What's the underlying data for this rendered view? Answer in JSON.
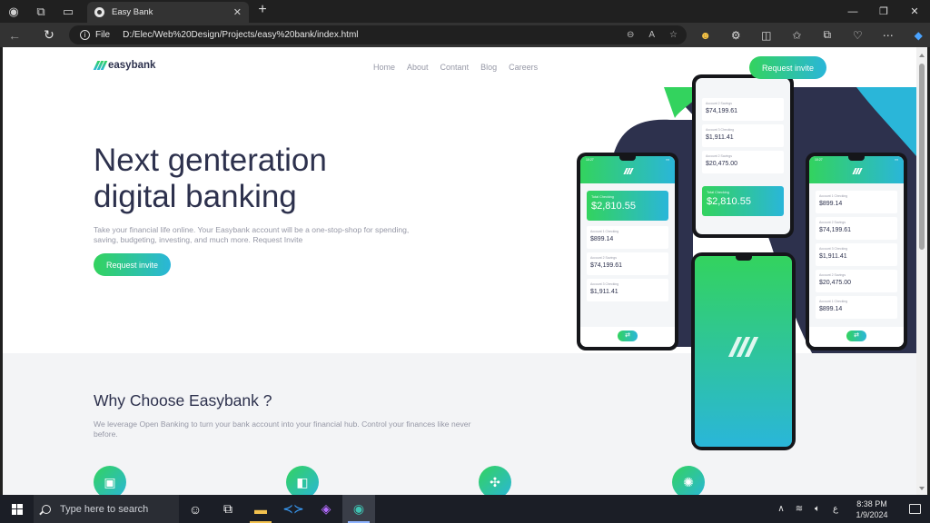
{
  "browser": {
    "tab_title": "Easy Bank",
    "tab_close": "✕",
    "new_tab": "+",
    "address_label": "File",
    "url": "D:/Elec/Web%20Design/Projects/easy%20bank/index.html",
    "window_controls": [
      "—",
      "❐",
      "✕"
    ]
  },
  "page": {
    "logo_text": "easybank",
    "nav_links": [
      "Home",
      "About",
      "Contant",
      "Blog",
      "Careers"
    ],
    "nav_cta": "Request invite",
    "hero": {
      "title_line1": "Next genteration",
      "title_line2": "digital banking",
      "description": "Take your financial life online. Your Easybank account will be a one-stop-shop for spending, saving, budgeting, investing, and much more. Request Invite",
      "cta": "Request invite"
    },
    "why": {
      "title": "Why Choose Easybank ?",
      "description": "We leverage Open Banking to turn your bank account into your financial hub. Control your finances like never before."
    },
    "mockups": {
      "total_label": "Total Checking",
      "total_value": "$2,810.55",
      "account_label_1": "Account 1 Checking",
      "account_label_2": "Account 2 Savings",
      "account_label_3": "Account 3 Checking",
      "values": [
        "$899.14",
        "$74,199.61",
        "$1,911.41",
        "$20,475.00"
      ]
    }
  },
  "taskbar": {
    "search_placeholder": "Type here to search",
    "time": "8:38 PM",
    "date": "1/9/2024",
    "lang": "ع"
  },
  "colors": {
    "brand_dark": "#2d314d",
    "brand_green": "#33d35e",
    "brand_cyan": "#2ab6d9",
    "text_gray": "#9698a6"
  }
}
